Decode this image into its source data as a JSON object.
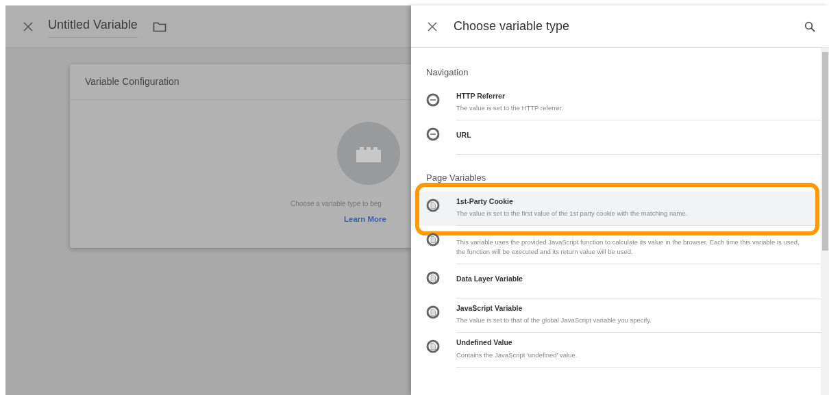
{
  "editor": {
    "title": "Untitled Variable",
    "card": {
      "title": "Variable Configuration",
      "hint": "Choose a variable type to beg",
      "link": "Learn More"
    }
  },
  "panel": {
    "title": "Choose variable type",
    "sections": [
      {
        "heading": "Navigation",
        "items": [
          {
            "kind": "navigation",
            "title": "HTTP Referrer",
            "description": "The value is set to the HTTP referrer.",
            "highlighted": false
          },
          {
            "kind": "navigation",
            "title": "URL",
            "highlighted": false
          }
        ]
      },
      {
        "heading": "Page Variables",
        "items": [
          {
            "kind": "page",
            "title": "1st-Party Cookie",
            "description": "The value is set to the first value of the 1st party cookie with the matching name.",
            "highlighted": true
          },
          {
            "kind": "page",
            "description": "This variable uses the provided JavaScript function to calculate its value in the browser. Each time this variable is used, the function will be executed and its return value will be used.",
            "highlighted": false
          },
          {
            "kind": "page",
            "title": "Data Layer Variable",
            "highlighted": false
          },
          {
            "kind": "page",
            "title": "JavaScript Variable",
            "description": "The value is set to that of the global JavaScript variable you specify.",
            "highlighted": false
          },
          {
            "kind": "page",
            "title": "Undefined Value",
            "description": "Contains the JavaScript 'undefined' value.",
            "highlighted": false
          }
        ]
      }
    ]
  }
}
